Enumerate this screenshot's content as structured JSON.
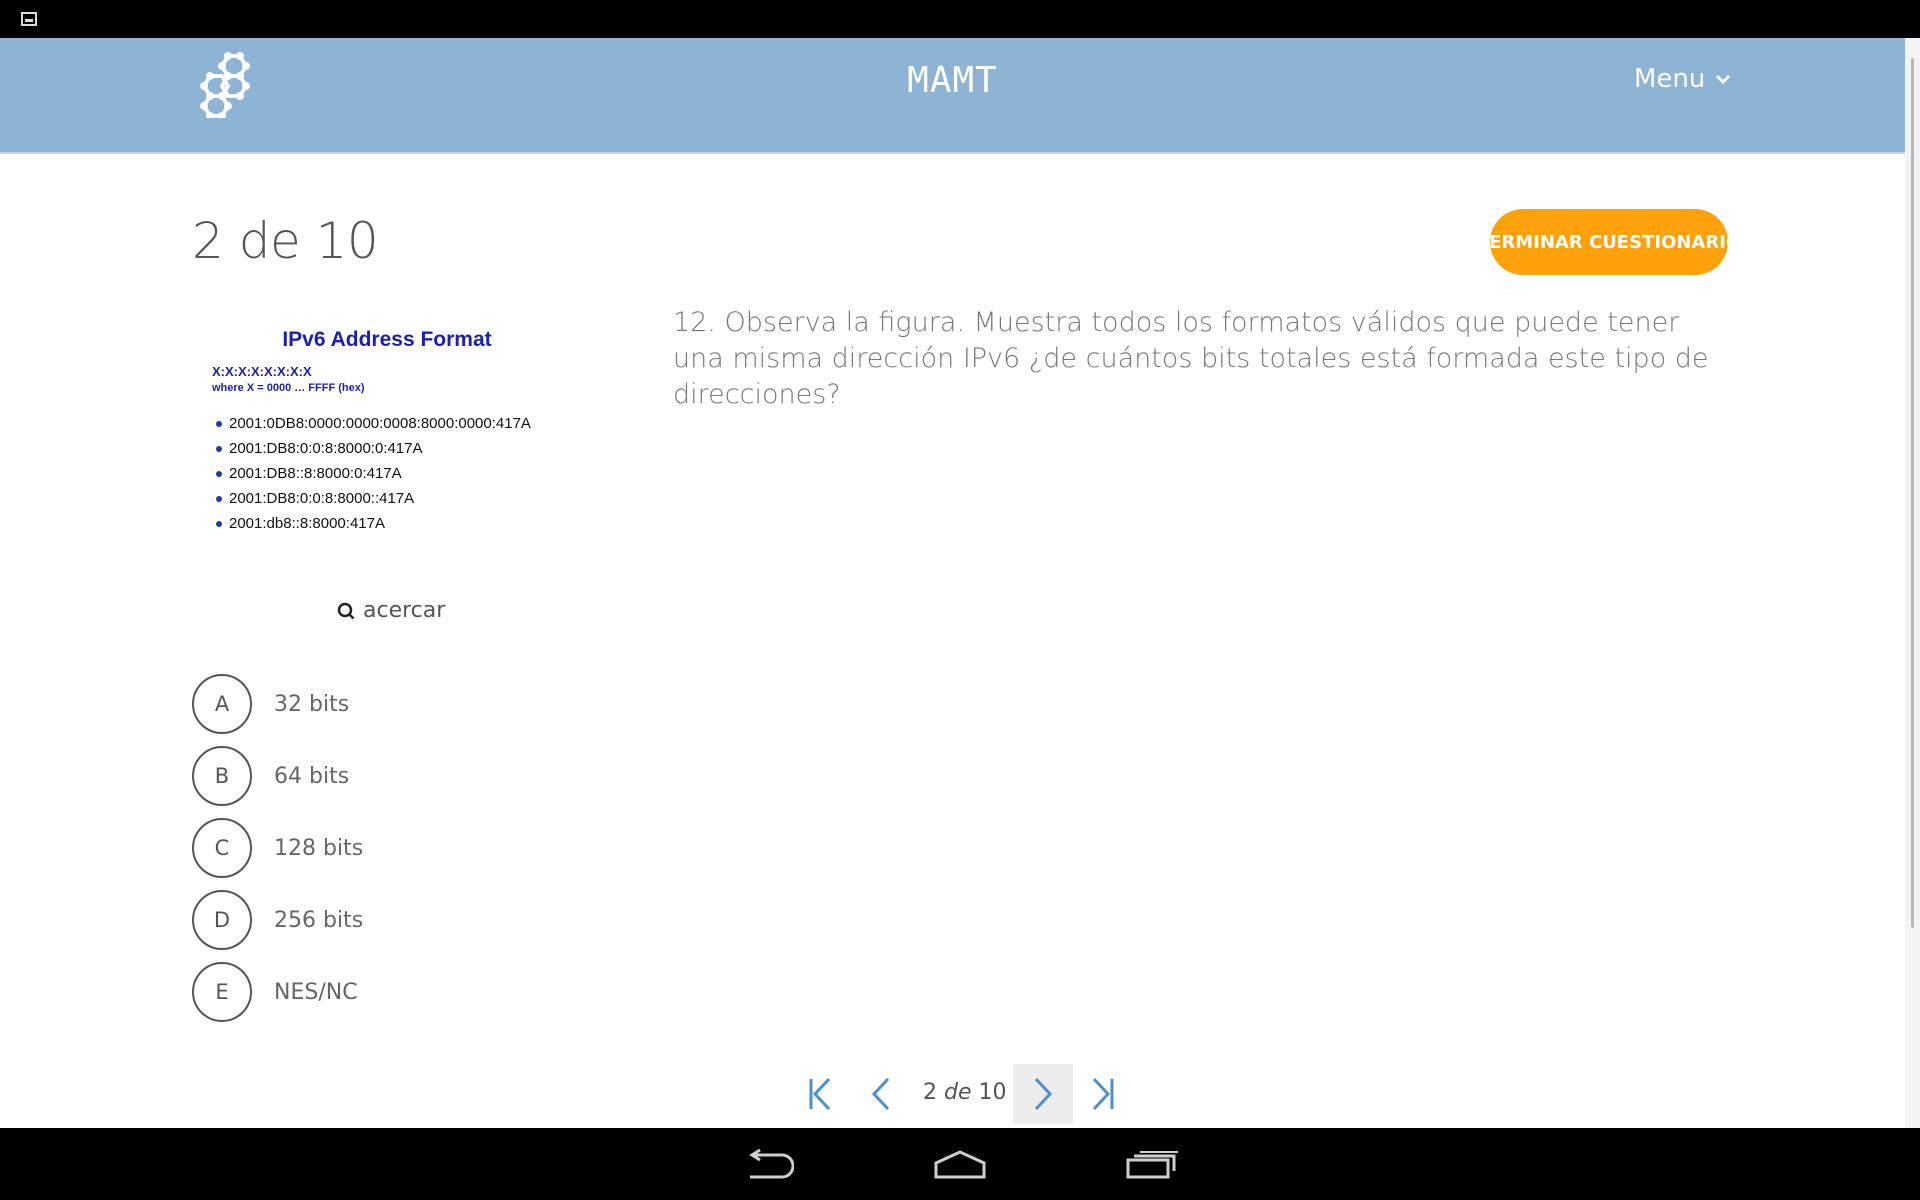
{
  "status_bar": {
    "icon": "image-icon"
  },
  "header": {
    "logo_icon": "hexagon-molecule-icon",
    "title": "MAMT",
    "menu_label": "Menu",
    "background": "#8db3d5"
  },
  "quiz": {
    "counter": "2 de 10",
    "finish_label": "TERMINAR CUESTIONARIO",
    "finish_color": "#ffa10a",
    "question": "12. Observa la figura. Muestra todos los formatos válidos que puede tener una misma dirección IPv6 ¿de cuántos bits totales está formada este tipo de direcciones?",
    "figure": {
      "title": "IPv6 Address Format",
      "line1": "X:X:X:X:X:X:X:X",
      "line2": "where X = 0000 … FFFF (hex)",
      "addresses": [
        "2001:0DB8:0000:0000:0008:8000:0000:417A",
        "2001:DB8:0:0:8:8000:0:417A",
        "2001:DB8::8:8000:0:417A",
        "2001:DB8:0:0:8:8000::417A",
        "2001:db8::8:8000:417A"
      ]
    },
    "zoom_label": "acercar",
    "options": [
      {
        "letter": "A",
        "text": "32 bits"
      },
      {
        "letter": "B",
        "text": "64 bits"
      },
      {
        "letter": "C",
        "text": "128 bits"
      },
      {
        "letter": "D",
        "text": "256 bits"
      },
      {
        "letter": "E",
        "text": "NES/NC"
      }
    ]
  },
  "pager": {
    "current": "2",
    "separator": "de",
    "total": "10"
  },
  "android_nav": {
    "back": "back-icon",
    "home": "home-icon",
    "recents": "recents-icon"
  }
}
